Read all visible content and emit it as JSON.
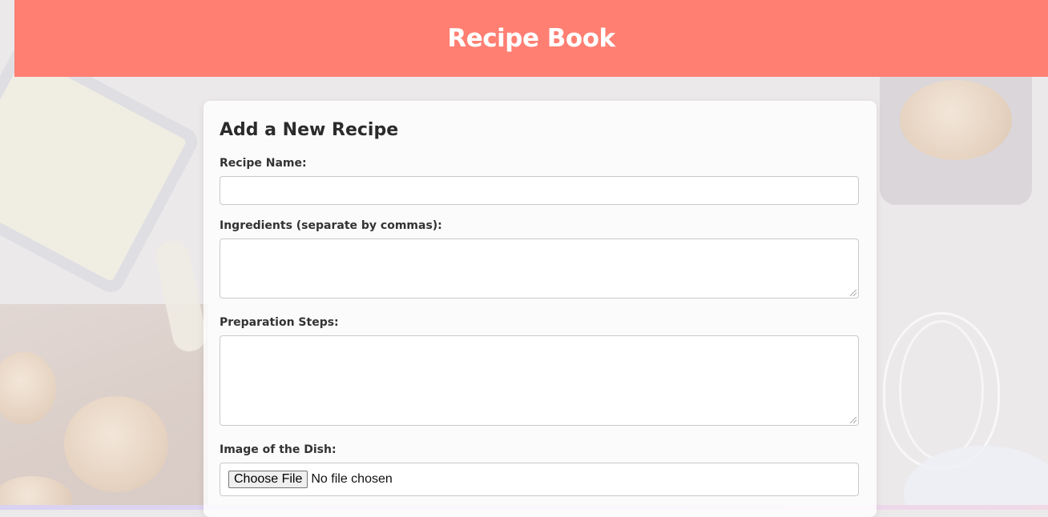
{
  "header": {
    "title": "Recipe Book"
  },
  "form": {
    "heading": "Add a New Recipe",
    "recipe_name": {
      "label": "Recipe Name:",
      "value": ""
    },
    "ingredients": {
      "label": "Ingredients (separate by commas):",
      "value": ""
    },
    "steps": {
      "label": "Preparation Steps:",
      "value": ""
    },
    "image": {
      "label": "Image of the Dish:",
      "button_label": "Choose File",
      "status": "No file chosen"
    }
  },
  "colors": {
    "header_bg": "#ff7f72",
    "header_text": "#ffffff",
    "card_bg": "#ffffff"
  }
}
